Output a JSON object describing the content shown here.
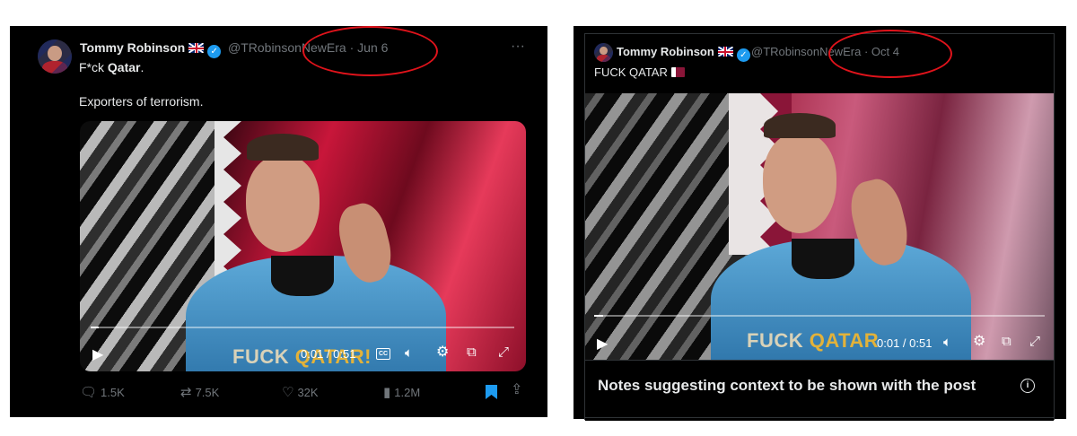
{
  "left_post": {
    "author_name": "Tommy Robinson",
    "handle": "@TRobinsonNewEra",
    "separator": "·",
    "date": "Jun 6",
    "more_icon": "more-horizontal-icon",
    "text_line1_prefix": "F*ck ",
    "text_line1_bold": "Qatar",
    "text_line1_suffix": ".",
    "text_line2": "Exporters of terrorism.",
    "video": {
      "caption_word1": "FUCK",
      "caption_word2": "QATAR!",
      "time": "0:01 / 0:51",
      "cc_label": "CC",
      "progress": 0.02
    },
    "actions": {
      "replies": "1.5K",
      "reposts": "7.5K",
      "likes": "32K",
      "views": "1.2M"
    }
  },
  "right_post": {
    "author_name": "Tommy Robinson",
    "handle": "@TRobinsonNewEra",
    "separator": "·",
    "date": "Oct 4",
    "text_line1": "FUCK QATAR",
    "video": {
      "caption_word1": "FUCK",
      "caption_word2": "QATAR",
      "time": "0:01 / 0:51",
      "progress": 0.02
    },
    "notes_banner": "Notes suggesting context to be shown with the post"
  },
  "colors": {
    "annotation_circle": "#e0131b",
    "bookmark_active": "#1d9bf0",
    "verified": "#1d9bf0"
  }
}
